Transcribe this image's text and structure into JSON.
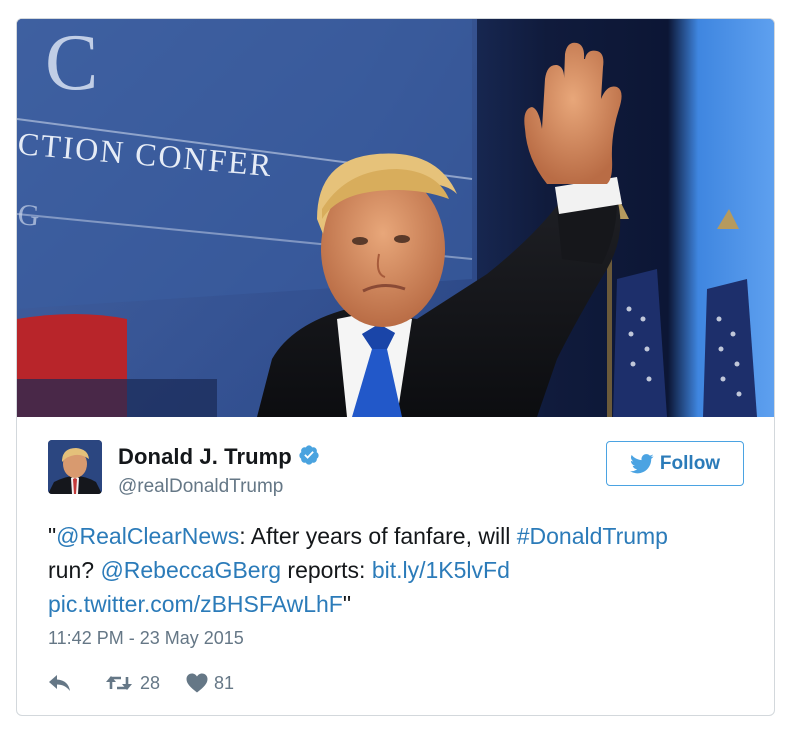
{
  "tweet": {
    "photo_alt": "",
    "author": {
      "display_name": "Donald J. Trump",
      "handle": "@realDonaldTrump",
      "verified": true
    },
    "follow_label": "Follow",
    "text": {
      "quote_open": "\"",
      "mention_1": "@RealClearNews",
      "part_1": ": After years of fanfare, will ",
      "hashtag": "#DonaldTrump",
      "part_2": " run? ",
      "mention_2": "@RebeccaGBerg",
      "part_3": " reports: ",
      "link": "bit.ly/1K5lvFd",
      "pic_link": "pic.twitter.com/zBHSFAwLhF",
      "quote_close": "\""
    },
    "timestamp": "11:42 PM - 23 May 2015",
    "retweet_count": "28",
    "like_count": "81"
  },
  "icons": {
    "reply": "reply-icon",
    "retweet": "retweet-icon",
    "like": "heart-icon",
    "verified": "verified-badge-icon",
    "bird": "twitter-bird-icon"
  },
  "colors": {
    "link": "#2b7bb9",
    "verified": "#4aa3df",
    "muted": "#657786",
    "border": "#d3d8dc"
  },
  "photo_signage": {
    "letter": "C",
    "line_1": "CTION CONFER",
    "line_2": "G"
  }
}
